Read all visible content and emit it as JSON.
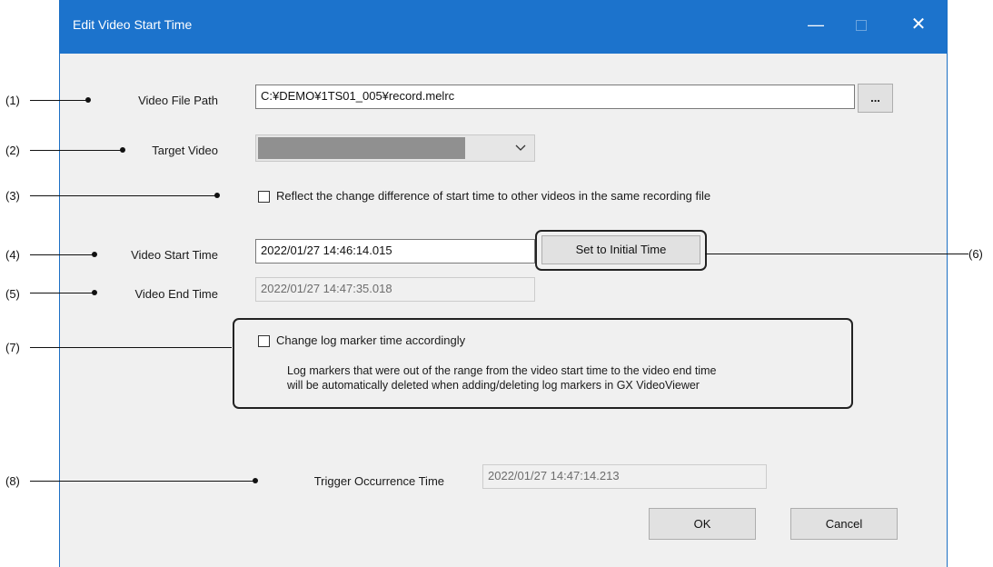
{
  "window": {
    "title": "Edit Video Start Time",
    "minimize_glyph": "—",
    "close_glyph": "✕"
  },
  "fields": {
    "video_file_path": {
      "label": "Video File Path",
      "value": "C:¥DEMO¥1TS01_005¥record.melrc",
      "browse_label": "..."
    },
    "target_video": {
      "label": "Target Video",
      "value": ""
    },
    "reflect_change": {
      "label": "Reflect the change difference of start time to other videos in the same recording file",
      "checked": false
    },
    "video_start_time": {
      "label": "Video Start Time",
      "value": "2022/01/27 14:46:14.015",
      "reset_label": "Set to Initial Time"
    },
    "video_end_time": {
      "label": "Video End Time",
      "value": "2022/01/27 14:47:35.018"
    },
    "change_log_marker": {
      "label": "Change log marker time accordingly",
      "checked": false,
      "note_line1": "Log markers that were out of the range from the video start time to the video end time",
      "note_line2": "will be automatically deleted when adding/deleting log markers in GX VideoViewer"
    },
    "trigger_occurrence_time": {
      "label": "Trigger Occurrence Time",
      "value": "2022/01/27 14:47:14.213"
    }
  },
  "buttons": {
    "ok": "OK",
    "cancel": "Cancel"
  },
  "annotations": {
    "a1": "(1)",
    "a2": "(2)",
    "a3": "(3)",
    "a4": "(4)",
    "a5": "(5)",
    "a6": "(6)",
    "a7": "(7)",
    "a8": "(8)"
  },
  "colors": {
    "titlebar": "#1c73cc",
    "dialog_bg": "#f0f0f0",
    "button_bg": "#e1e1e1",
    "select_fill": "#909090"
  }
}
